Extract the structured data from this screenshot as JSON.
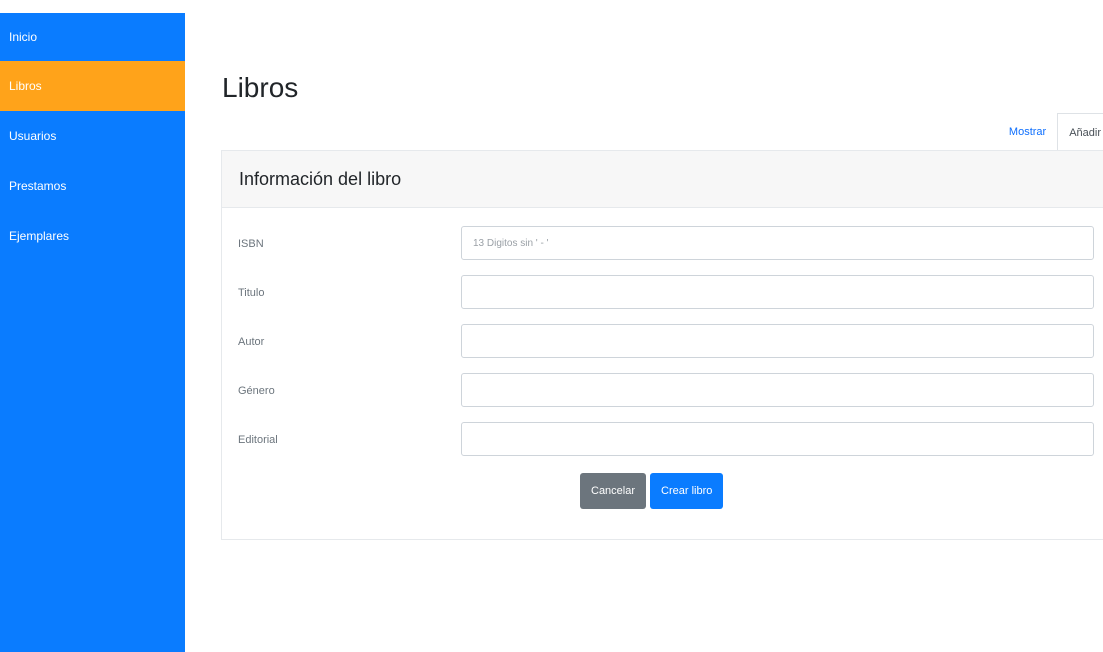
{
  "sidebar": {
    "items": [
      {
        "label": "Inicio"
      },
      {
        "label": "Libros"
      },
      {
        "label": "Usuarios"
      },
      {
        "label": "Prestamos"
      },
      {
        "label": "Ejemplares"
      }
    ],
    "active_index": 1
  },
  "main": {
    "title": "Libros",
    "tabs": [
      {
        "label": "Mostrar"
      },
      {
        "label": "Añadir"
      }
    ],
    "card": {
      "header": "Información del libro",
      "fields": [
        {
          "label": "ISBN",
          "value": "",
          "placeholder": "13 Digitos sin ' - '"
        },
        {
          "label": "Titulo",
          "value": "",
          "placeholder": ""
        },
        {
          "label": "Autor",
          "value": "",
          "placeholder": ""
        },
        {
          "label": "Género",
          "value": "",
          "placeholder": ""
        },
        {
          "label": "Editorial",
          "value": "",
          "placeholder": ""
        }
      ],
      "cancel_label": "Cancelar",
      "submit_label": "Crear libro"
    }
  },
  "colors": {
    "sidebar_bg": "#0a7cff",
    "active_item_bg": "#ffa31a",
    "primary_button": "#0a7cff",
    "secondary_button": "#6c757d"
  }
}
